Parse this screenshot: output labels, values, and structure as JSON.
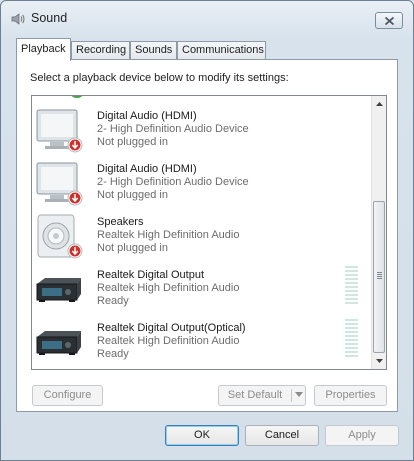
{
  "window": {
    "title": "Sound"
  },
  "tabs": [
    {
      "label": "Playback",
      "active": true
    },
    {
      "label": "Recording",
      "active": false
    },
    {
      "label": "Sounds",
      "active": false
    },
    {
      "label": "Communications",
      "active": false
    }
  ],
  "instruction": "Select a playback device below to modify its settings:",
  "devices": [
    {
      "name": "Digital Audio (HDMI)",
      "description": "2- High Definition Audio Device",
      "status": "Not plugged in",
      "icon": "monitor-icon",
      "badge": "unplugged-arrow-icon"
    },
    {
      "name": "Digital Audio (HDMI)",
      "description": "2- High Definition Audio Device",
      "status": "Not plugged in",
      "icon": "monitor-icon",
      "badge": "unplugged-arrow-icon"
    },
    {
      "name": "Speakers",
      "description": "Realtek High Definition Audio",
      "status": "Not plugged in",
      "icon": "speaker-icon",
      "badge": "unplugged-arrow-icon"
    },
    {
      "name": "Realtek Digital Output",
      "description": "Realtek High Definition Audio",
      "status": "Ready",
      "icon": "digital-output-device-icon",
      "level": 0
    },
    {
      "name": "Realtek Digital Output(Optical)",
      "description": "Realtek High Definition Audio",
      "status": "Ready",
      "icon": "digital-output-device-icon",
      "level": 0
    }
  ],
  "buttons": {
    "configure": "Configure",
    "set_default": "Set Default",
    "properties": "Properties",
    "ok": "OK",
    "cancel": "Cancel",
    "apply": "Apply"
  },
  "colors": {
    "unplugged_badge": "#d0302c",
    "meter_idle": "#cfe7dc",
    "default_button_border": "#3c7fb1"
  }
}
